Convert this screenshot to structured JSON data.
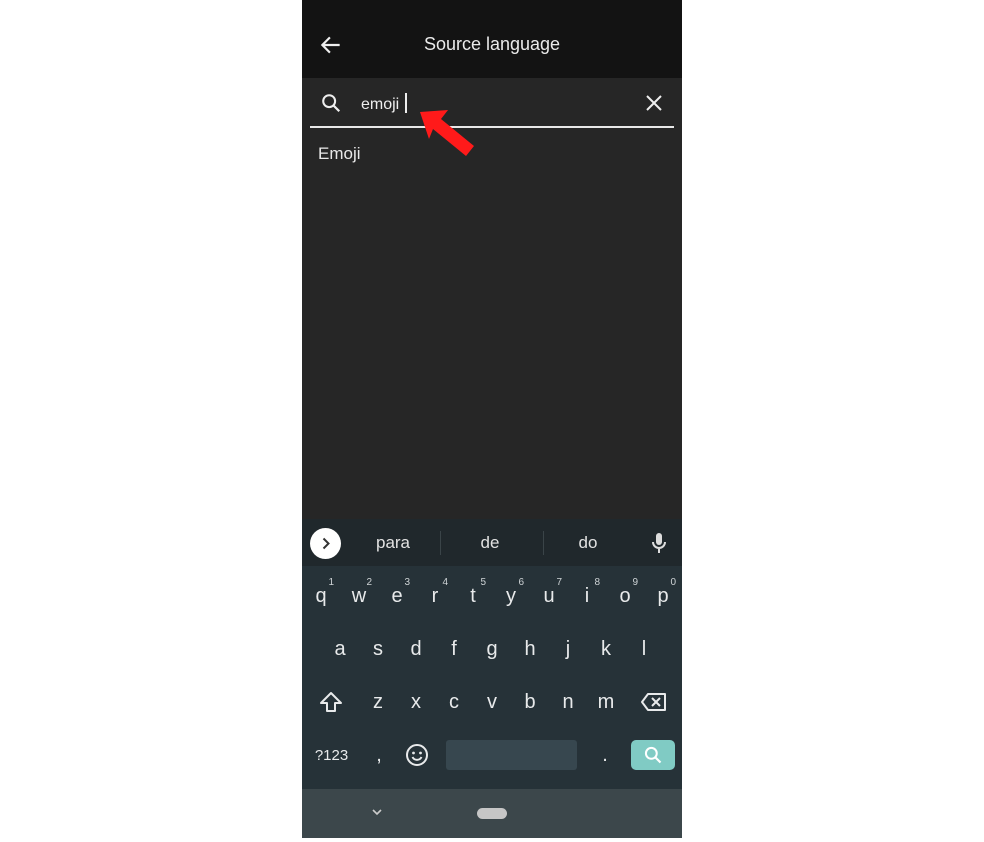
{
  "header": {
    "title": "Source language",
    "back_icon": "arrow-left-icon"
  },
  "search": {
    "value": "emoji",
    "search_icon": "search-icon",
    "clear_icon": "close-icon"
  },
  "results": [
    {
      "label": "Emoji"
    }
  ],
  "annotation": {
    "arrow_color": "#ff1a1a"
  },
  "keyboard": {
    "suggestions": [
      "para",
      "de",
      "do"
    ],
    "row1": [
      [
        "q",
        "1"
      ],
      [
        "w",
        "2"
      ],
      [
        "e",
        "3"
      ],
      [
        "r",
        "4"
      ],
      [
        "t",
        "5"
      ],
      [
        "y",
        "6"
      ],
      [
        "u",
        "7"
      ],
      [
        "i",
        "8"
      ],
      [
        "o",
        "9"
      ],
      [
        "p",
        "0"
      ]
    ],
    "row2": [
      "a",
      "s",
      "d",
      "f",
      "g",
      "h",
      "j",
      "k",
      "l"
    ],
    "row3": [
      "z",
      "x",
      "c",
      "v",
      "b",
      "n",
      "m"
    ],
    "symbols_label": "?123",
    "comma": ",",
    "period": ".",
    "accent_color": "#80cbc4"
  }
}
